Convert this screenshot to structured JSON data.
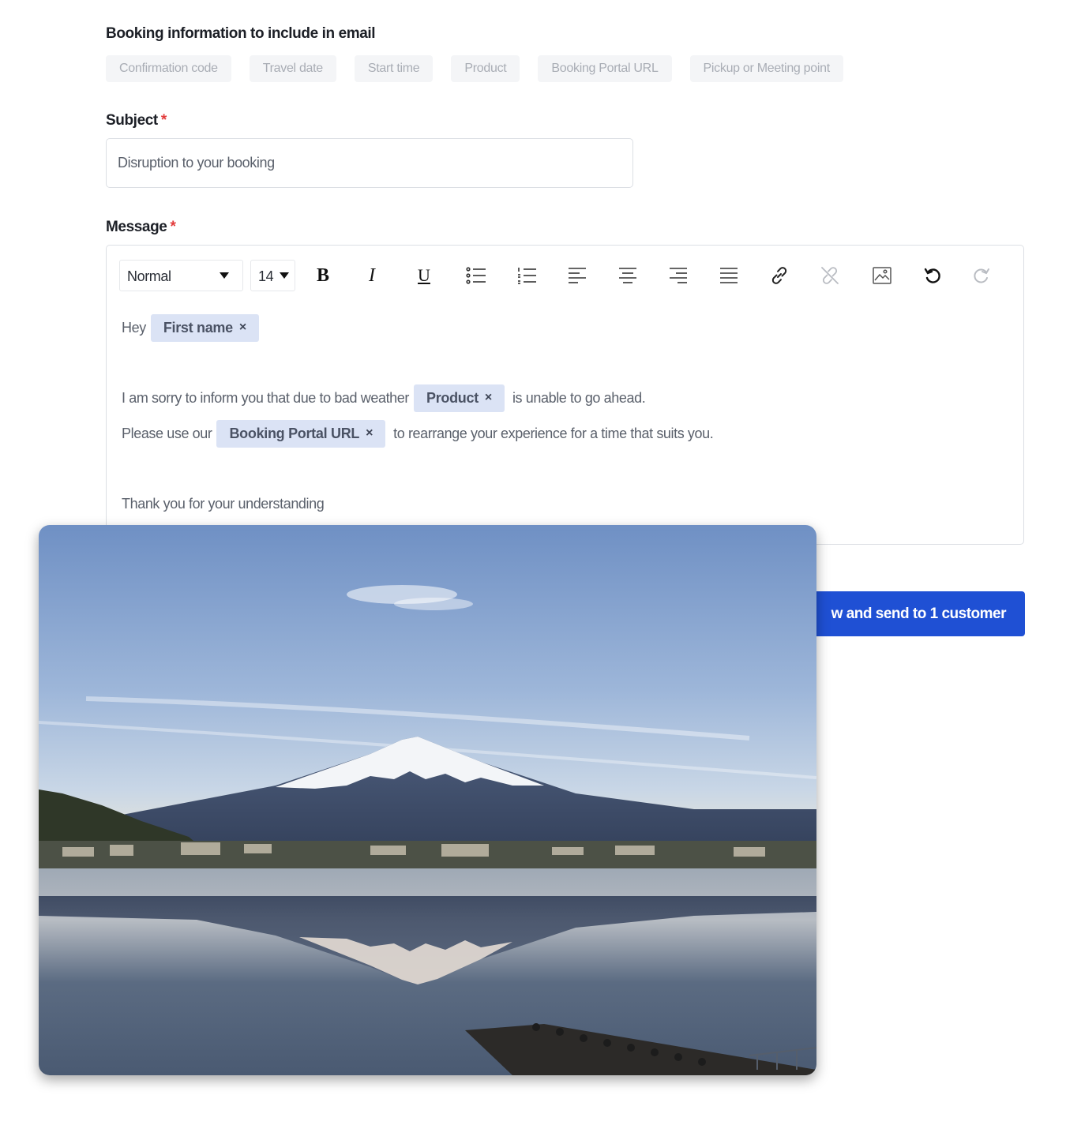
{
  "booking_info": {
    "heading": "Booking information to include in email",
    "chips": [
      "Confirmation code",
      "Travel date",
      "Start time",
      "Product",
      "Booking Portal URL",
      "Pickup or Meeting point"
    ]
  },
  "subject": {
    "label": "Subject",
    "required_mark": "*",
    "value": "Disruption to your booking"
  },
  "message": {
    "label": "Message",
    "required_mark": "*",
    "toolbar": {
      "text_style": "Normal",
      "font_size": "14",
      "buttons": [
        "bold-icon",
        "italic-icon",
        "underline-icon",
        "bullet-list-icon",
        "numbered-list-icon",
        "align-left-icon",
        "align-center-icon",
        "align-right-icon",
        "align-justify-icon",
        "link-icon",
        "unlink-icon",
        "image-icon",
        "undo-icon",
        "redo-icon"
      ],
      "bold_glyph": "B",
      "italic_glyph": "I",
      "underline_glyph": "U"
    },
    "body": {
      "greeting": "Hey",
      "tag_first_name": "First name",
      "line1_before": "I am sorry to inform you that due to bad weather",
      "tag_product": "Product",
      "line1_after": "is unable to go ahead.",
      "line2_before": "Please use our",
      "tag_portal": "Booking Portal URL",
      "line2_after": "to rearrange your experience for a time that suits you.",
      "closing": "Thank you for your understanding",
      "tag_remove_glyph": "×"
    }
  },
  "send_button": {
    "label": "w and send to 1 customer"
  },
  "colors": {
    "accent": "#1f50d4",
    "required": "#e23b3b",
    "tag_bg": "#dbe3f5",
    "chip_bg": "#f4f5f7"
  },
  "overlay_photo": {
    "subject": "snow-capped mountain reflected in lake"
  }
}
